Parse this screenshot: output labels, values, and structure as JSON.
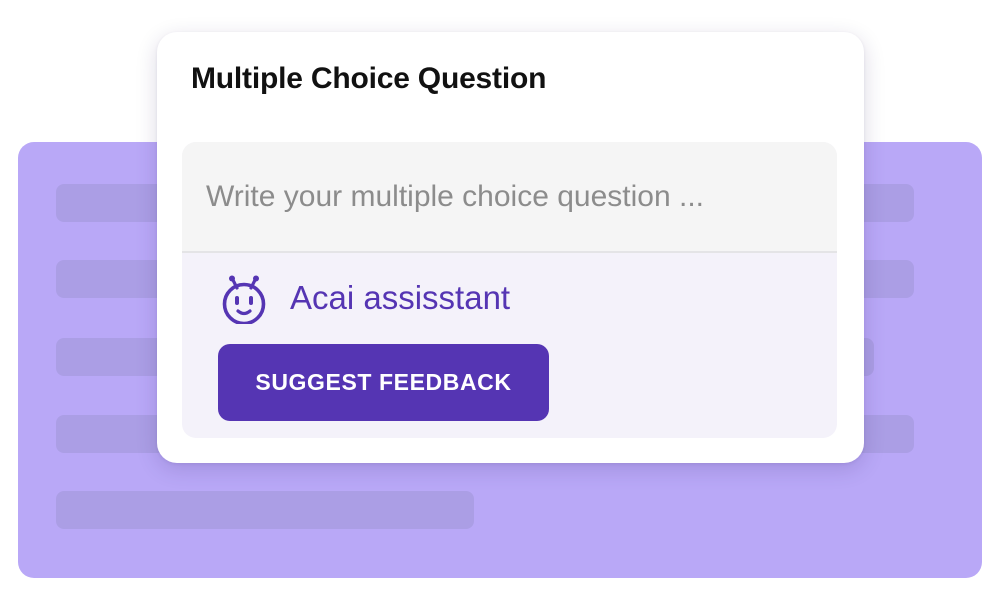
{
  "card": {
    "title": "Multiple Choice Question"
  },
  "question": {
    "placeholder": "Write your multiple choice question ...",
    "value": ""
  },
  "assistant": {
    "icon": "robot-face-icon",
    "label": "Acai assisstant"
  },
  "actions": {
    "suggest_label": "SUGGEST FEEDBACK"
  },
  "colors": {
    "background_card": "#b9a8f7",
    "skeleton_bar": "#ab9ee5",
    "accent": "#5535b3",
    "input_background": "#f5f5f5",
    "panel_background": "#f4f2fa"
  }
}
